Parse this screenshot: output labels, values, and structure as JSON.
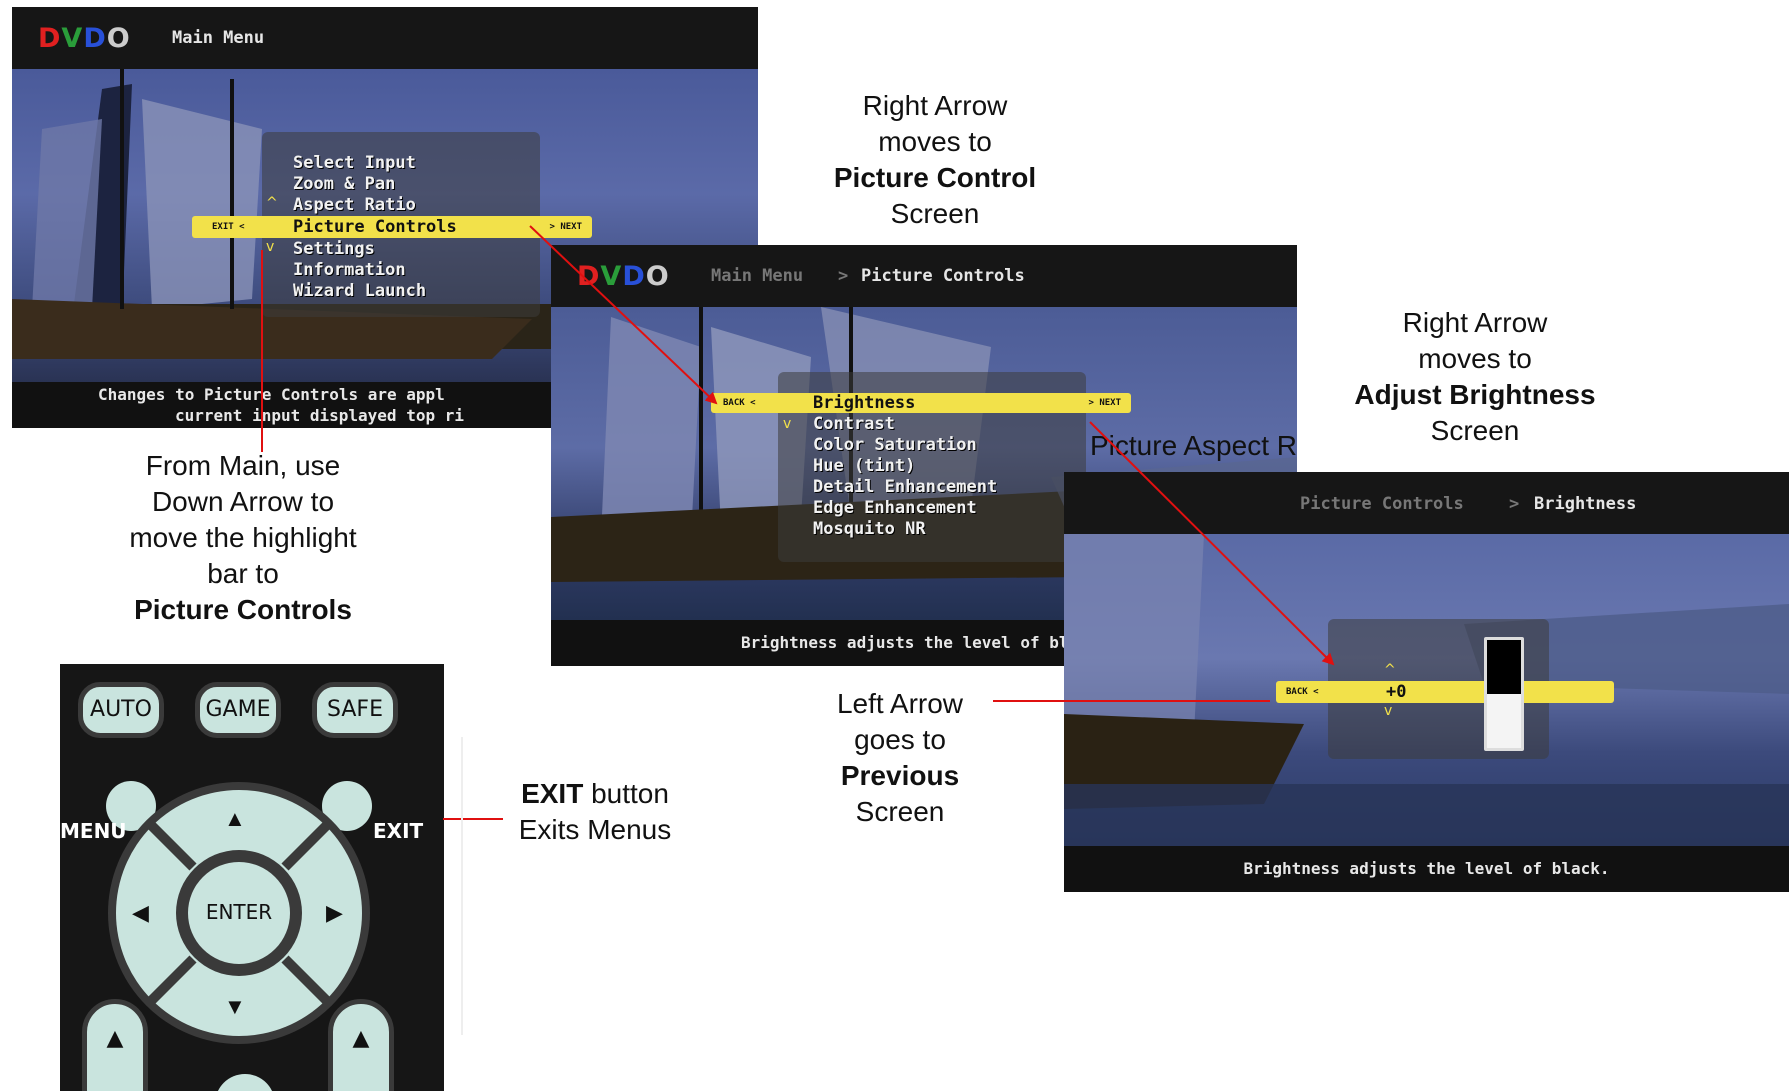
{
  "screen_main": {
    "logo": "DVDO",
    "title": "Main Menu",
    "menu_items": [
      "Select Input",
      "Zoom & Pan",
      "Aspect Ratio",
      "Picture Controls",
      "Settings",
      "Information",
      "Wizard Launch"
    ],
    "highlight_left_tag": "EXIT <",
    "highlight_right_tag": "> NEXT",
    "footer_line1": "Changes to Picture Controls are appl",
    "footer_line2": "current input displayed top ri"
  },
  "screen_picture": {
    "logo": "DVDO",
    "breadcrumb_parent": "Main Menu",
    "breadcrumb_sep": ">",
    "breadcrumb_current": "Picture Controls",
    "menu_items": [
      "Brightness",
      "Contrast",
      "Color Saturation",
      "Hue (tint)",
      "Detail Enhancement",
      "Edge Enhancement",
      "Mosquito NR"
    ],
    "highlight_left_tag": "BACK <",
    "highlight_right_tag": "> NEXT",
    "footer": "Brightness adjusts the level of black."
  },
  "screen_brightness": {
    "breadcrumb_parent": "Picture Controls",
    "breadcrumb_sep": ">",
    "breadcrumb_current": "Brightness",
    "highlight_left_tag": "BACK <",
    "value": "+0",
    "footer": "Brightness adjusts the level of black.",
    "level_fraction": 0.5
  },
  "captions": {
    "right_arrow_1": {
      "l1": "Right Arrow",
      "l2": "moves to",
      "bold": "Picture Control",
      "l4": "Screen"
    },
    "right_arrow_2": {
      "l1": "Right Arrow",
      "l2": "moves to",
      "bold": "Adjust Brightness",
      "l4": "Screen"
    },
    "from_main": {
      "l1": "From Main, use",
      "l2": "Down Arrow to",
      "l3": "move the highlight",
      "l4": "bar to",
      "bold": "Picture Controls"
    },
    "left_arrow": {
      "l1": "Left Arrow",
      "l2": "goes to",
      "bold": "Previous",
      "l4": "Screen"
    },
    "exit_button": {
      "bold": "EXIT",
      "rest": " button",
      "l2": "Exits Menus"
    },
    "stray": "Picture Aspect R"
  },
  "remote": {
    "auto": "AUTO",
    "game": "GAME",
    "safe": "SAFE",
    "menu": "MENU",
    "exit": "EXIT",
    "enter": "ENTER",
    "up": "▲",
    "down": "▼",
    "left": "◀",
    "right": "▶"
  },
  "colors": {
    "highlight": "#f2e14a",
    "annotation_line": "#e01010",
    "remote_button": "#c9e4de"
  }
}
